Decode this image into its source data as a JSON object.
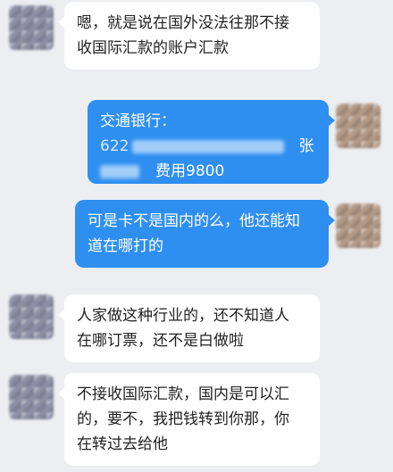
{
  "messages": [
    {
      "side": "left",
      "lines": [
        "嗯，就是说在国外没法往那不接",
        "收国际汇款的账户汇款"
      ]
    },
    {
      "side": "right",
      "bank_label": "交通银行：",
      "account_prefix": "622",
      "account_suffix": "张",
      "fee": "费用9800"
    },
    {
      "side": "right",
      "lines": [
        "可是卡不是国内的么，他还能知",
        "道在哪打的"
      ]
    },
    {
      "side": "left",
      "lines": [
        "人家做这种行业的，还不知道人",
        "在哪订票，还不是白做啦"
      ]
    },
    {
      "side": "left",
      "lines": [
        "不接收国际汇款，国内是可以汇",
        "的，要不，我把钱转到你那，你",
        "在转过去给他"
      ]
    }
  ],
  "colors": {
    "background": "#eceef1",
    "incoming_bubble": "#ffffff",
    "outgoing_bubble": "#2f8ff0"
  }
}
